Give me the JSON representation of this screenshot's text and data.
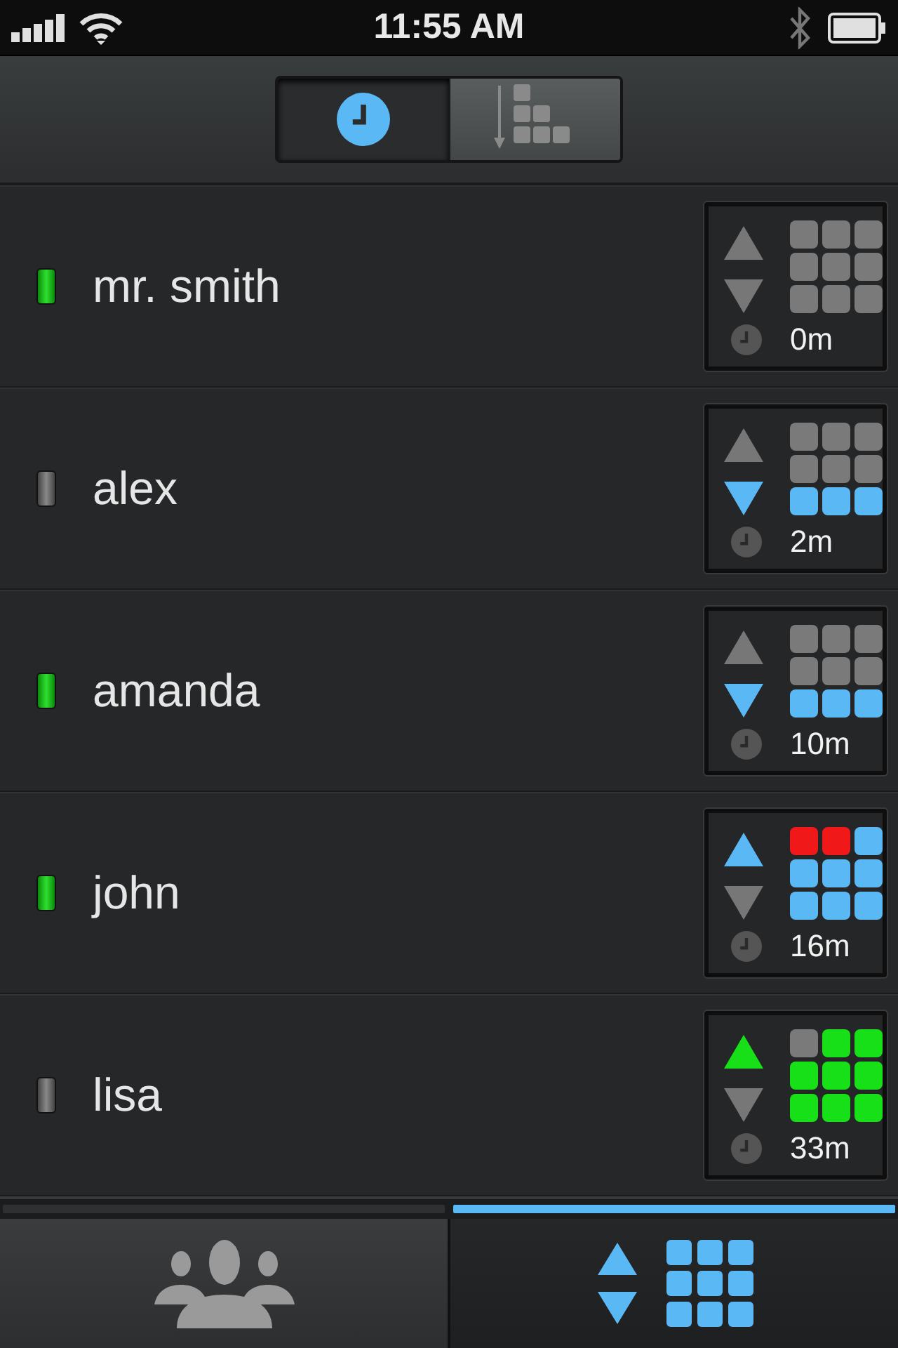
{
  "status_bar": {
    "time": "11:55 AM"
  },
  "segments": [
    {
      "kind": "clock",
      "selected": true
    },
    {
      "kind": "sort",
      "selected": false
    }
  ],
  "rows": [
    {
      "name": "mr. smith",
      "online": true,
      "arrows": [
        {
          "kind": "up",
          "on": false
        },
        {
          "kind": "down",
          "on": false
        }
      ],
      "elapsed": "0m",
      "cells": [
        {
          "color": "#7a7a7a"
        },
        {
          "color": "#7a7a7a"
        },
        {
          "color": "#7a7a7a"
        },
        {
          "color": "#7a7a7a"
        },
        {
          "color": "#7a7a7a"
        },
        {
          "color": "#7a7a7a"
        },
        {
          "color": "#7a7a7a"
        },
        {
          "color": "#7a7a7a"
        },
        {
          "color": "#7a7a7a"
        }
      ]
    },
    {
      "name": "alex",
      "online": false,
      "arrows": [
        {
          "kind": "up",
          "on": false
        },
        {
          "kind": "down",
          "on": true,
          "color": "#5ab8f5"
        }
      ],
      "elapsed": "2m",
      "cells": [
        {
          "color": "#7a7a7a"
        },
        {
          "color": "#7a7a7a"
        },
        {
          "color": "#7a7a7a"
        },
        {
          "color": "#7a7a7a"
        },
        {
          "color": "#7a7a7a"
        },
        {
          "color": "#7a7a7a"
        },
        {
          "color": "#5ab8f5"
        },
        {
          "color": "#5ab8f5"
        },
        {
          "color": "#5ab8f5"
        }
      ]
    },
    {
      "name": "amanda",
      "online": true,
      "arrows": [
        {
          "kind": "up",
          "on": false
        },
        {
          "kind": "down",
          "on": true,
          "color": "#5ab8f5"
        }
      ],
      "elapsed": "10m",
      "cells": [
        {
          "color": "#7a7a7a"
        },
        {
          "color": "#7a7a7a"
        },
        {
          "color": "#7a7a7a"
        },
        {
          "color": "#7a7a7a"
        },
        {
          "color": "#7a7a7a"
        },
        {
          "color": "#7a7a7a"
        },
        {
          "color": "#5ab8f5"
        },
        {
          "color": "#5ab8f5"
        },
        {
          "color": "#5ab8f5"
        }
      ]
    },
    {
      "name": "john",
      "online": true,
      "arrows": [
        {
          "kind": "up",
          "on": true,
          "color": "#5ab8f5"
        },
        {
          "kind": "down",
          "on": false
        }
      ],
      "elapsed": "16m",
      "cells": [
        {
          "color": "#f01818"
        },
        {
          "color": "#f01818"
        },
        {
          "color": "#5ab8f5"
        },
        {
          "color": "#5ab8f5"
        },
        {
          "color": "#5ab8f5"
        },
        {
          "color": "#5ab8f5"
        },
        {
          "color": "#5ab8f5"
        },
        {
          "color": "#5ab8f5"
        },
        {
          "color": "#5ab8f5"
        }
      ]
    },
    {
      "name": "lisa",
      "online": false,
      "arrows": [
        {
          "kind": "up",
          "on": true,
          "color": "#18e018"
        },
        {
          "kind": "down",
          "on": false
        }
      ],
      "elapsed": "33m",
      "cells": [
        {
          "color": "#7a7a7a"
        },
        {
          "color": "#18e018"
        },
        {
          "color": "#18e018"
        },
        {
          "color": "#18e018"
        },
        {
          "color": "#18e018"
        },
        {
          "color": "#18e018"
        },
        {
          "color": "#18e018"
        },
        {
          "color": "#18e018"
        },
        {
          "color": "#18e018"
        }
      ]
    }
  ],
  "bottom_tabs": [
    {
      "kind": "people",
      "selected": false
    },
    {
      "kind": "grid",
      "selected": true
    }
  ]
}
